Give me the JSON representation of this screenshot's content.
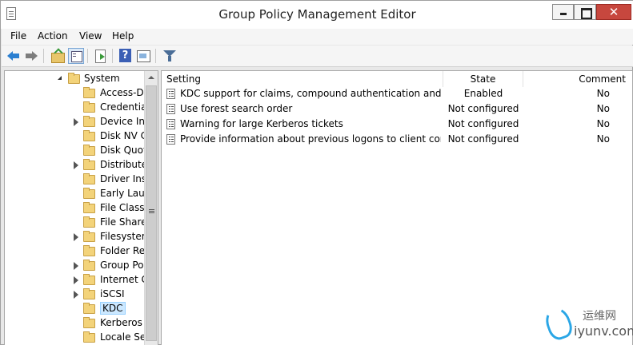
{
  "window": {
    "title": "Group Policy Management Editor",
    "close_glyph": "✕"
  },
  "menu": {
    "items": [
      "File",
      "Action",
      "View",
      "Help"
    ]
  },
  "tree": {
    "items": [
      {
        "label": "System",
        "expander": "expanded",
        "selected": false
      },
      {
        "label": "Access-De",
        "expander": "none",
        "selected": false
      },
      {
        "label": "Credential",
        "expander": "none",
        "selected": false
      },
      {
        "label": "Device Inst",
        "expander": "collapsed",
        "selected": false
      },
      {
        "label": "Disk NV Ca",
        "expander": "none",
        "selected": false
      },
      {
        "label": "Disk Quota",
        "expander": "none",
        "selected": false
      },
      {
        "label": "Distributed",
        "expander": "collapsed",
        "selected": false
      },
      {
        "label": "Driver Inst",
        "expander": "none",
        "selected": false
      },
      {
        "label": "Early Laun",
        "expander": "none",
        "selected": false
      },
      {
        "label": "File Classif",
        "expander": "none",
        "selected": false
      },
      {
        "label": "File Share",
        "expander": "none",
        "selected": false
      },
      {
        "label": "Filesystem",
        "expander": "collapsed",
        "selected": false
      },
      {
        "label": "Folder Red",
        "expander": "none",
        "selected": false
      },
      {
        "label": "Group Pol",
        "expander": "collapsed",
        "selected": false
      },
      {
        "label": "Internet Co",
        "expander": "collapsed",
        "selected": false
      },
      {
        "label": "iSCSI",
        "expander": "collapsed",
        "selected": false
      },
      {
        "label": "KDC",
        "expander": "none",
        "selected": true
      },
      {
        "label": "Kerberos",
        "expander": "none",
        "selected": false
      },
      {
        "label": "Locale Ser",
        "expander": "none",
        "selected": false
      }
    ]
  },
  "list": {
    "columns": {
      "setting": "Setting",
      "state": "State",
      "comment": "Comment"
    },
    "rows": [
      {
        "setting": "KDC support for claims, compound authentication and Kerb...",
        "state": "Enabled",
        "comment": "No"
      },
      {
        "setting": "Use forest search order",
        "state": "Not configured",
        "comment": "No"
      },
      {
        "setting": "Warning for large Kerberos tickets",
        "state": "Not configured",
        "comment": "No"
      },
      {
        "setting": "Provide information about previous logons to client compu...",
        "state": "Not configured",
        "comment": "No"
      }
    ]
  },
  "watermark": {
    "cn": "运维网",
    "en": "iyunv.com"
  },
  "colors": {
    "accent": "#2a7fd1",
    "close": "#c7473e",
    "selection": "#cce8ff"
  }
}
